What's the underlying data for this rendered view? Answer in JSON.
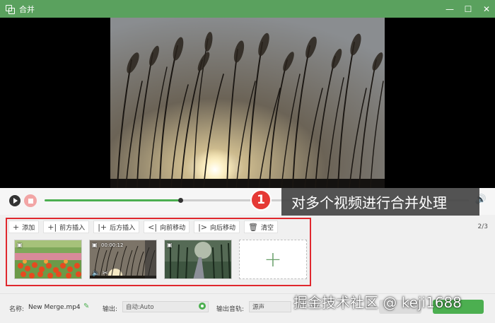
{
  "window": {
    "title": "合并",
    "minimize_glyph": "—",
    "maximize_glyph": "☐",
    "close_glyph": "✕"
  },
  "player": {
    "progress": 0.32,
    "play_icon": "play-icon",
    "stop_icon": "stop-icon",
    "volume_glyph": "🔊"
  },
  "callout": {
    "number": "1",
    "text": "对多个视频进行合并处理"
  },
  "toolbar": {
    "add": "添加",
    "insert_before": "前方插入",
    "insert_after": "后方插入",
    "move_forward": "向前移动",
    "move_backward": "向后移动",
    "clear": "清空",
    "count": "2/3"
  },
  "clips": [
    {
      "name": "tulips",
      "time": ""
    },
    {
      "name": "reeds-sunset",
      "time": "00:00:12"
    },
    {
      "name": "forest-road",
      "time": ""
    }
  ],
  "add_clip_glyph": "+",
  "bottom": {
    "name_label": "名称:",
    "name_value": "New Merge.mp4",
    "output_label": "输出:",
    "output_value": "自动:Auto",
    "audio_label": "输出音轨:",
    "audio_value": "源声"
  },
  "watermark": "掘金技术社区 @ keji1688",
  "colors": {
    "accent": "#5aa15e",
    "callout_red": "#e53935",
    "highlight_border": "#e0282e"
  }
}
